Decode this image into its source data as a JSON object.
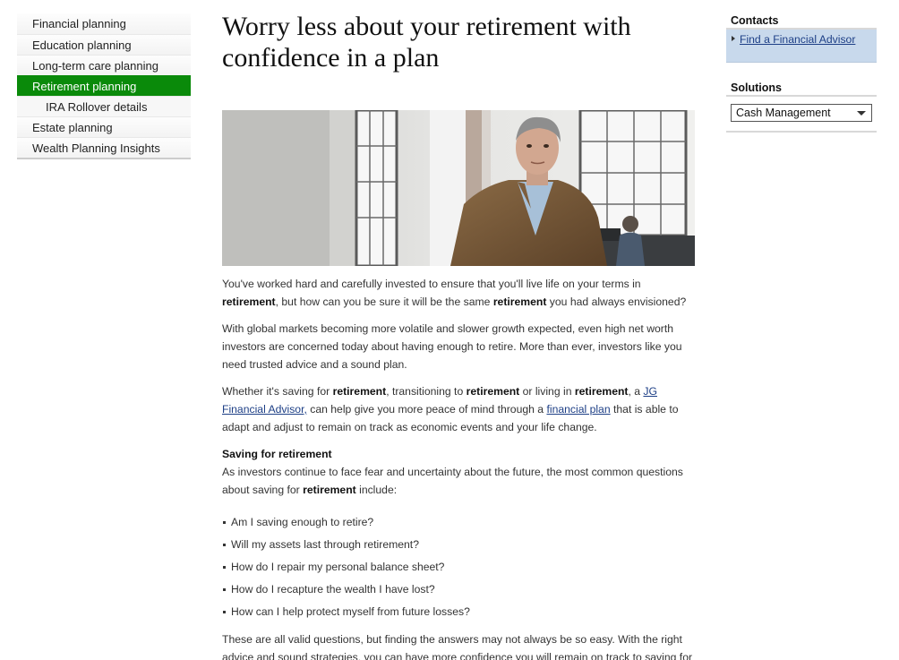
{
  "leftnav": {
    "items": [
      {
        "label": "Financial planning"
      },
      {
        "label": "Education planning"
      },
      {
        "label": "Long-term care planning"
      },
      {
        "label": "Retirement planning"
      },
      {
        "label": "IRA Rollover details"
      },
      {
        "label": "Estate planning"
      },
      {
        "label": "Wealth Planning Insights"
      }
    ]
  },
  "main": {
    "title": "Worry less about your retirement with confidence in a plan",
    "p1": {
      "t1": "You've worked hard and carefully invested to ensure that you'll live life on your terms in ",
      "b1": "retirement",
      "t2": ", but how can you be sure it will be the same ",
      "b2": "retirement",
      "t3": " you had always envisioned?"
    },
    "p2": "With global markets becoming more volatile and slower growth expected, even high net worth investors are concerned today about having enough to retire. More than ever, investors like you need trusted advice and a sound plan.",
    "p3": {
      "t1": "Whether it's saving for ",
      "b1": "retirement",
      "t2": ", transitioning to ",
      "b2": "retirement",
      "t3": " or living in ",
      "b3": "retirement",
      "t4": ", a ",
      "link1": "JG Financial Advisor,",
      "t5": " can help give you more peace of mind through a ",
      "link2": "financial plan",
      "t6": " that is able to adapt and adjust to remain on track as economic events and your life change."
    },
    "saving_heading": "Saving for retirement",
    "p4": {
      "t1": "As investors continue to face fear and uncertainty about the future, the most common questions about saving for ",
      "b1": "retirement",
      "t2": " include:"
    },
    "bullets": [
      "Am I saving enough to retire?",
      "Will my assets last through retirement?",
      "How do I repair my personal balance sheet?",
      "How do I recapture the wealth I have lost?",
      "How can I help protect myself from future losses?"
    ],
    "p5": "These are all valid questions, but finding the answers may not always be so easy. With the right advice and sound strategies, you can have more confidence you will remain on track to saving for"
  },
  "right": {
    "contacts_heading": "Contacts",
    "contact_link": "Find a Financial Advisor",
    "solutions_heading": "Solutions",
    "solutions_selected": "Cash Management"
  },
  "colors": {
    "nav_active": "#0a8a0a",
    "link": "#1d3f86",
    "contact_bg": "#c8d9ec"
  }
}
